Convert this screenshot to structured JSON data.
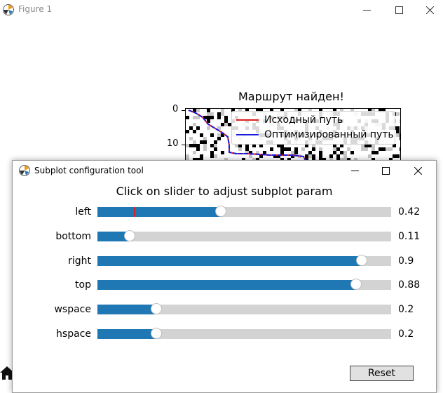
{
  "window": {
    "title": "Figure 1"
  },
  "plot": {
    "title": "Маршрут найден!",
    "yticks": [
      "0",
      "10"
    ],
    "legend": [
      {
        "label": "Исходный путь",
        "color": "#e02020"
      },
      {
        "label": "Оптимизированный путь",
        "color": "#1a1adc"
      }
    ]
  },
  "dialog": {
    "title": "Subplot configuration tool",
    "heading": "Click on slider to adjust subplot param",
    "sliders": [
      {
        "label": "left",
        "value": "0.42",
        "fraction": 0.42,
        "initial": 0.125
      },
      {
        "label": "bottom",
        "value": "0.11",
        "fraction": 0.11
      },
      {
        "label": "right",
        "value": "0.9",
        "fraction": 0.9
      },
      {
        "label": "top",
        "value": "0.88",
        "fraction": 0.88
      },
      {
        "label": "wspace",
        "value": "0.2",
        "fraction": 0.2
      },
      {
        "label": "hspace",
        "value": "0.2",
        "fraction": 0.2
      }
    ],
    "reset_label": "Reset"
  },
  "colors": {
    "slider_fill": "#1f77b4",
    "slider_track": "#d3d3d3",
    "initial_marker": "#d62728"
  },
  "icons": [
    "matplotlib-logo-icon",
    "minimize-icon",
    "maximize-icon",
    "close-icon",
    "home-icon"
  ]
}
